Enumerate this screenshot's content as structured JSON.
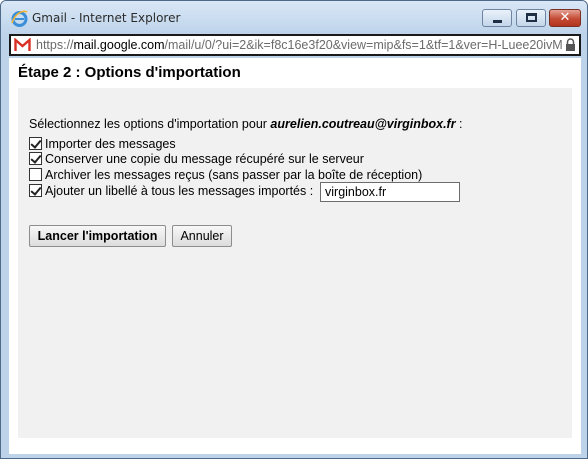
{
  "window": {
    "title": "Gmail - Internet Explorer",
    "close_label": "✕"
  },
  "address_bar": {
    "scheme": "https://",
    "host": "mail.google.com",
    "path": "/mail/u/0/?ui=2&ik=f8c16e3f20&view=mip&fs=1&tf=1&ver=H-Luee20ivM"
  },
  "page": {
    "title": "Étape 2 : Options d'importation",
    "intro_prefix": "Sélectionnez les options d'importation pour ",
    "intro_email": "aurelien.coutreau@virginbox.fr",
    "intro_suffix": " :",
    "options": [
      {
        "label": "Importer des messages",
        "checked": true
      },
      {
        "label": "Conserver une copie du message récupéré sur le serveur",
        "checked": true
      },
      {
        "label": "Archiver les messages reçus (sans passer par la boîte de réception)",
        "checked": false
      },
      {
        "label": "Ajouter un libellé à tous les messages importés :",
        "checked": true
      }
    ],
    "label_value": "virginbox.fr",
    "start_button": "Lancer l'importation",
    "cancel_button": "Annuler"
  },
  "icons": {
    "browser": "ie-icon",
    "site": "gmail-icon",
    "security": "lock-icon"
  }
}
